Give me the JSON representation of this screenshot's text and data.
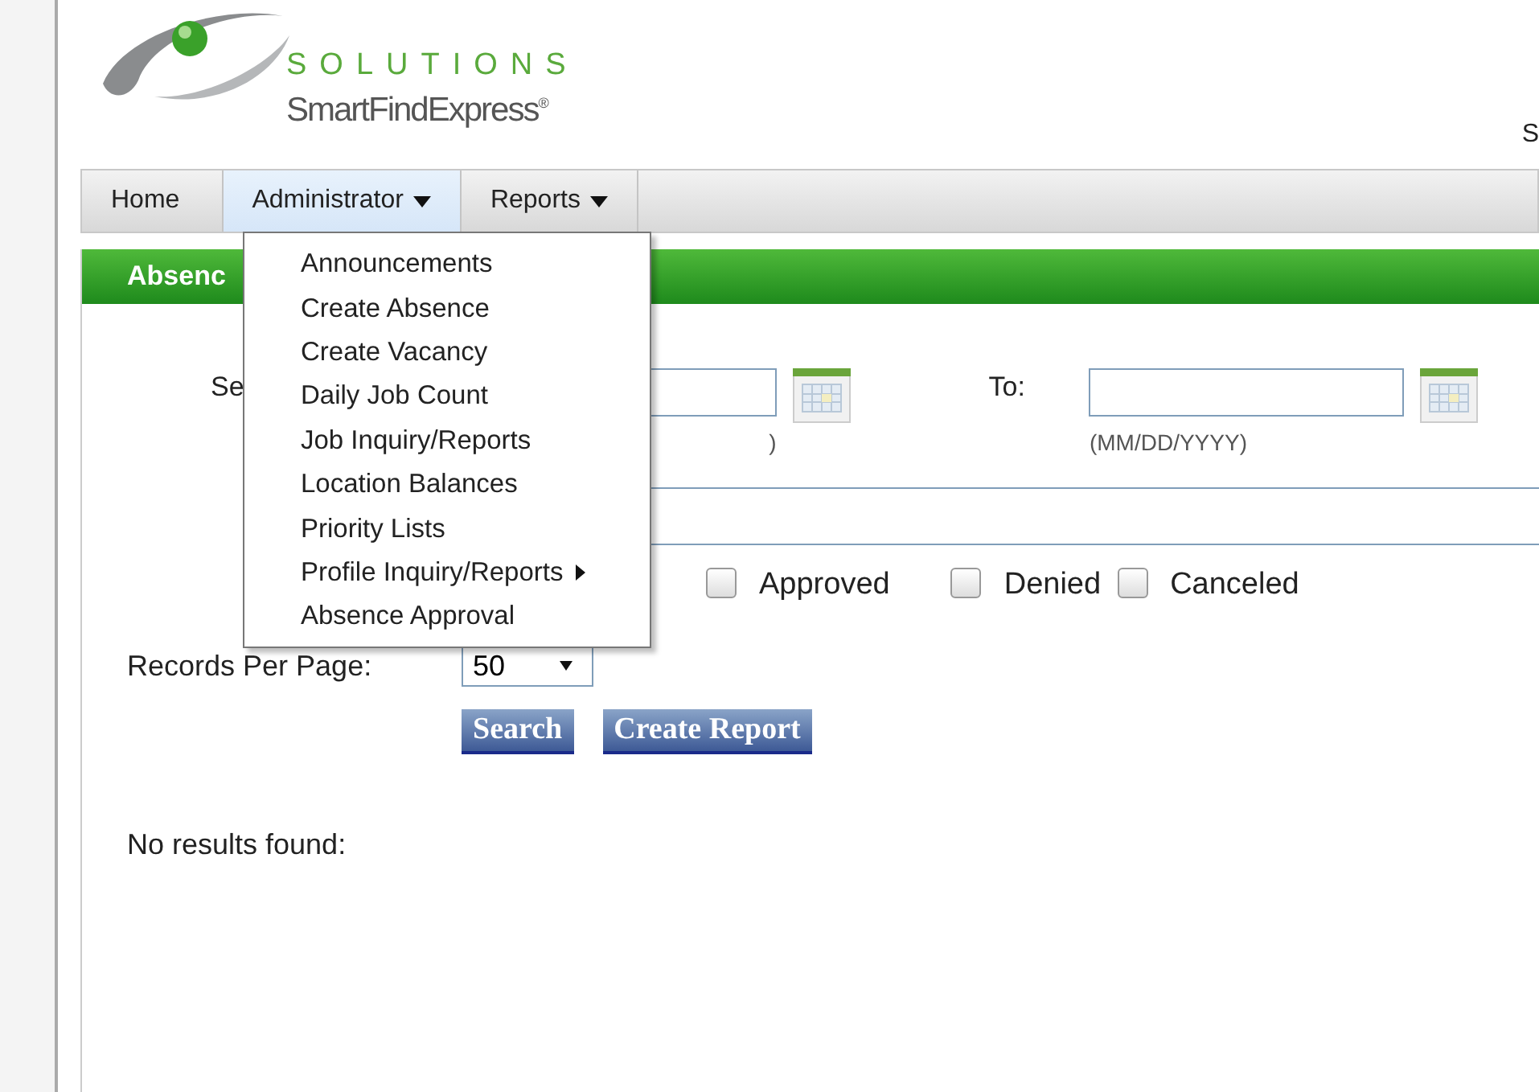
{
  "logo": {
    "tagline": "SOLUTIONS",
    "product": "SmartFindExpress",
    "mark": "®"
  },
  "header_right": "S",
  "nav": [
    {
      "label": "Home",
      "dropdown": false,
      "selected": false
    },
    {
      "label": "Administrator",
      "dropdown": true,
      "selected": true
    },
    {
      "label": "Reports",
      "dropdown": true,
      "selected": false
    }
  ],
  "menu": [
    {
      "label": "Announcements",
      "submenu": false
    },
    {
      "label": "Create Absence",
      "submenu": false
    },
    {
      "label": "Create Vacancy",
      "submenu": false
    },
    {
      "label": "Daily Job Count",
      "submenu": false
    },
    {
      "label": "Job Inquiry/Reports",
      "submenu": false
    },
    {
      "label": "Location Balances",
      "submenu": false
    },
    {
      "label": "Priority Lists",
      "submenu": false
    },
    {
      "label": "Profile Inquiry/Reports",
      "submenu": true
    },
    {
      "label": "Absence Approval",
      "submenu": false
    }
  ],
  "section_title": "Absenc",
  "date_from": {
    "label": "Se",
    "hint": ")"
  },
  "date_to": {
    "label": "To:",
    "hint": "(MM/DD/YYYY)"
  },
  "statuses": [
    {
      "label": "Approved",
      "checked": false
    },
    {
      "label": "Denied",
      "checked": false
    },
    {
      "label": "Canceled",
      "checked": false
    }
  ],
  "records_per_page": {
    "label": "Records Per Page:",
    "value": "50"
  },
  "buttons": [
    "Search",
    "Create Report"
  ],
  "result": "No results found:"
}
